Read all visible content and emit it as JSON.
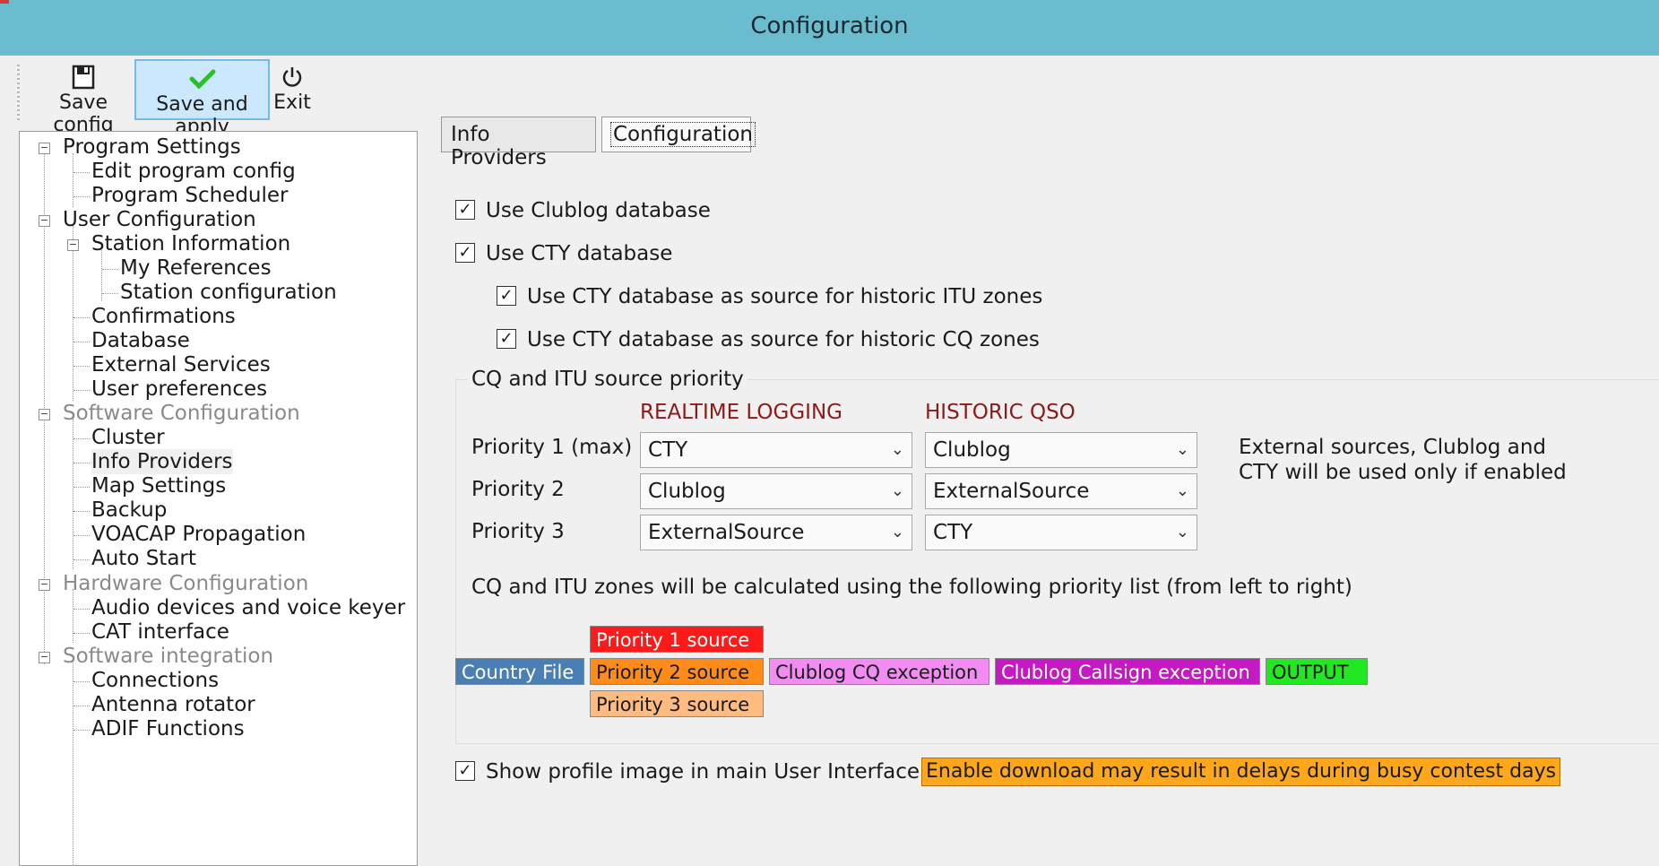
{
  "window": {
    "title": "Configuration"
  },
  "toolbar": {
    "save_config": "Save config",
    "save_and_apply": "Save and apply",
    "exit": "Exit"
  },
  "tree": {
    "program_settings": "Program Settings",
    "edit_program_config": "Edit program config",
    "program_scheduler": "Program Scheduler",
    "user_configuration": "User Configuration",
    "station_information": "Station Information",
    "my_references": "My References",
    "station_configuration": "Station configuration",
    "confirmations": "Confirmations",
    "database": "Database",
    "external_services": "External Services",
    "user_preferences": "User preferences",
    "software_configuration": "Software Configuration",
    "cluster": "Cluster",
    "info_providers": "Info Providers",
    "map_settings": "Map Settings",
    "backup": "Backup",
    "voacap": "VOACAP Propagation",
    "auto_start": "Auto Start",
    "hardware_configuration": "Hardware Configuration",
    "audio_devices": "Audio devices and voice keyer",
    "cat_interface": "CAT interface",
    "software_integration": "Software integration",
    "connections": "Connections",
    "antenna_rotator": "Antenna rotator",
    "adif_functions": "ADIF Functions"
  },
  "tabs": {
    "info_providers": "Info Providers",
    "configuration": "Configuration"
  },
  "options": {
    "use_clublog": "Use Clublog database",
    "use_cty": "Use CTY database",
    "cty_itu": "Use CTY database as source for historic ITU zones",
    "cty_cq": "Use CTY database as source for historic CQ zones",
    "checked_mark": "✓"
  },
  "priority": {
    "group_title": "CQ and ITU source priority",
    "realtime_header": "REALTIME LOGGING",
    "historic_header": "HISTORIC QSO",
    "p1_label": "Priority 1 (max)",
    "p2_label": "Priority 2",
    "p3_label": "Priority 3",
    "realtime": [
      "CTY",
      "Clublog",
      "ExternalSource"
    ],
    "historic": [
      "Clublog",
      "ExternalSource",
      "CTY"
    ],
    "note_line1": "External sources, Clublog and",
    "note_line2": "CTY will be used only if enabled",
    "chain_text": "CQ and ITU zones will be calculated using the following priority list (from left to right)"
  },
  "chain": {
    "country_file": "Country File",
    "p1_source": "Priority 1 source",
    "p2_source": "Priority 2 source",
    "p3_source": "Priority 3 source",
    "cq_exception": "Clublog CQ exception",
    "callsign_exception": "Clublog Callsign exception",
    "output": "OUTPUT",
    "colors": {
      "country_file": "#4a7fb5",
      "p1": "#ff1a1a",
      "p2": "#ff8c1a",
      "p3": "#ffbb80",
      "cq_exception": "#f28cf2",
      "callsign_exception": "#c31ac3",
      "output": "#22e822"
    }
  },
  "profile": {
    "show_image": "Show profile image in main User Interface",
    "warning": "Enable download may result in delays during busy contest days"
  }
}
